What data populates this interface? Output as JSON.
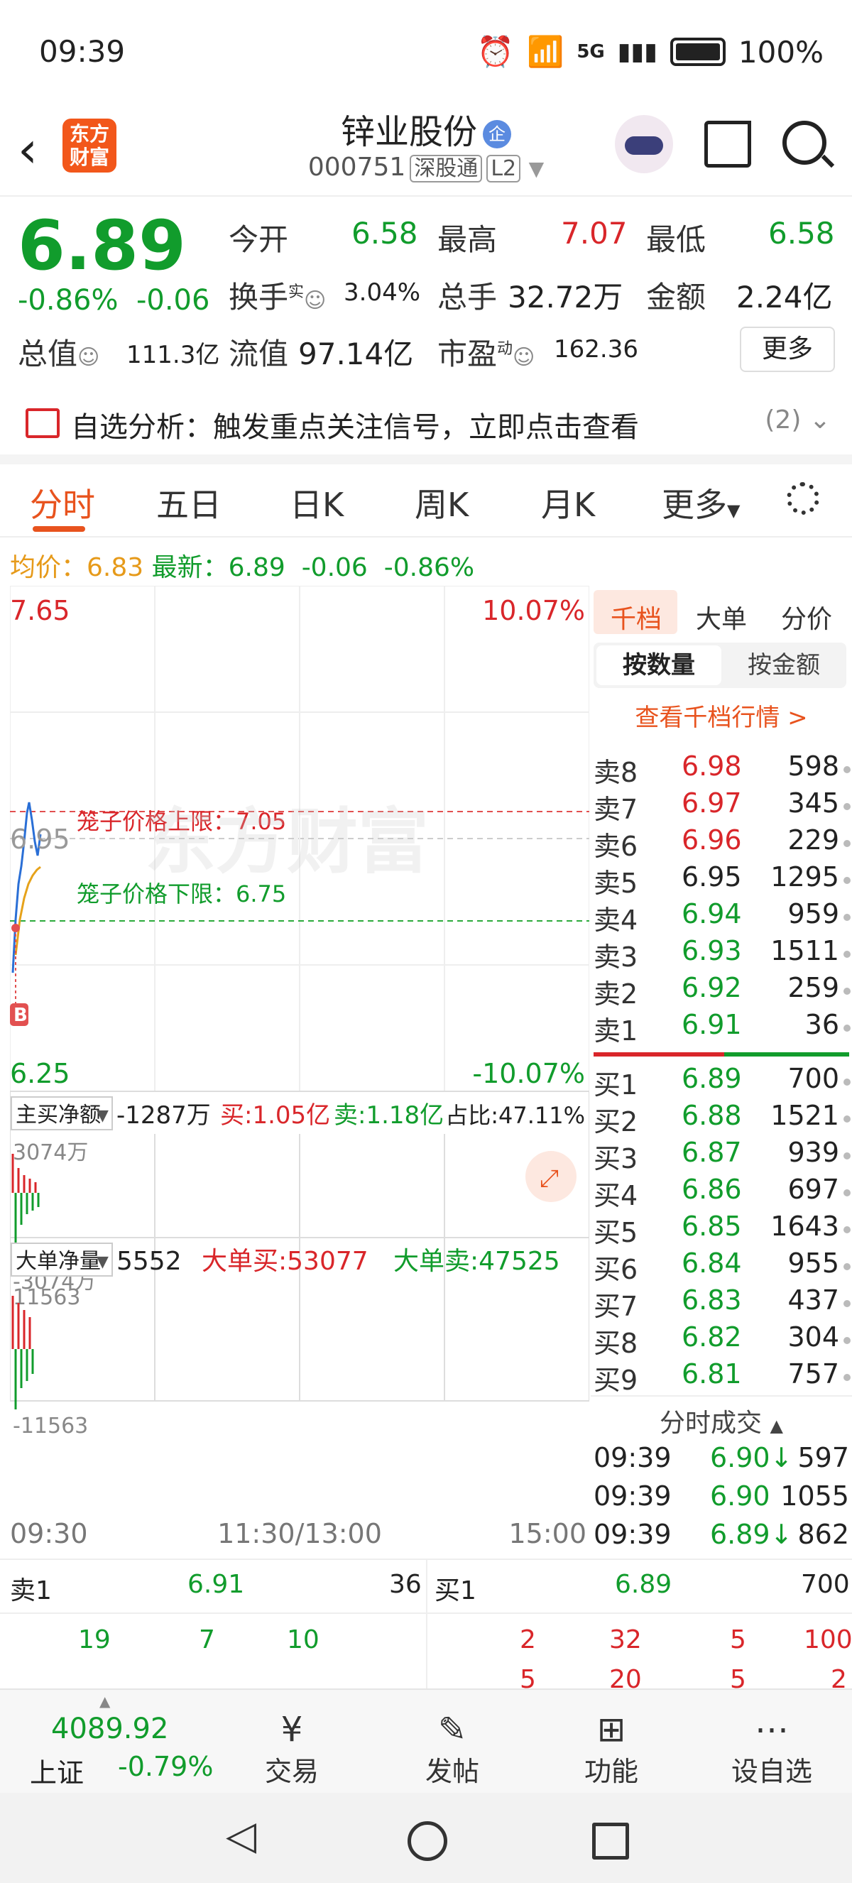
{
  "status": {
    "time": "09:39",
    "network": "5G",
    "battery": "100%"
  },
  "header": {
    "logo_line1": "东方",
    "logo_line2": "财富",
    "name": "锌业股份",
    "badge": "企",
    "code": "000751",
    "tag1": "深股通",
    "tag2": "L2"
  },
  "quote": {
    "price": "6.89",
    "change_pct": "-0.86%",
    "change": "-0.06",
    "open_label": "今开",
    "open": "6.58",
    "high_label": "最高",
    "high": "7.07",
    "low_label": "最低",
    "low": "6.58",
    "turnover_label": "换手",
    "turnover_sup": "实",
    "turnover": "3.04%",
    "volume_label": "总手",
    "volume": "32.72万",
    "amount_label": "金额",
    "amount": "2.24亿",
    "total_cap_label": "总值",
    "total_cap": "111.3亿",
    "float_cap_label": "流值",
    "float_cap": "97.14亿",
    "pe_label": "市盈",
    "pe_sup": "动",
    "pe": "162.36",
    "more": "更多"
  },
  "analysis": {
    "text": "自选分析：触发重点关注信号，立即点击查看",
    "count": "(2)"
  },
  "tabs": [
    "分时",
    "五日",
    "日K",
    "周K",
    "月K",
    "更多"
  ],
  "avg": {
    "avg_label": "均价：",
    "avg": "6.83",
    "latest_label": "最新：",
    "latest": "6.89",
    "chg": "-0.06",
    "pct": "-0.86%"
  },
  "chart": {
    "top_price": "7.65",
    "top_pct": "10.07%",
    "bottom_price": "6.25",
    "bottom_pct": "-10.07%",
    "mid_price": "6.95",
    "upper_limit": "笼子价格上限：7.05",
    "lower_limit": "笼子价格下限：6.75",
    "b_marker": "B",
    "watermark": "东方财富",
    "flow_label": "主买净额",
    "flow_value": "-1287万",
    "flow_buy": "买:1.05亿",
    "flow_sell": "卖:1.18亿",
    "flow_ratio": "占比:47.11%",
    "flow_top": "3074万",
    "flow_bottom": "-3074万",
    "big_label": "大单净量",
    "big_value": "5552",
    "big_buy": "大单买:53077",
    "big_sell": "大单卖:47525",
    "big_top": "11563",
    "big_bottom": "-11563",
    "time_start": "09:30",
    "time_mid": "11:30/13:00",
    "time_end": "15:00"
  },
  "orderbook": {
    "tabs": [
      "千档",
      "大单",
      "分价"
    ],
    "sub_tabs": [
      "按数量",
      "按金额"
    ],
    "link": "查看千档行情 >",
    "asks": [
      {
        "label": "卖8",
        "price": "6.98",
        "vol": "598"
      },
      {
        "label": "卖7",
        "price": "6.97",
        "vol": "345"
      },
      {
        "label": "卖6",
        "price": "6.96",
        "vol": "229"
      },
      {
        "label": "卖5",
        "price": "6.95",
        "vol": "1295"
      },
      {
        "label": "卖4",
        "price": "6.94",
        "vol": "959"
      },
      {
        "label": "卖3",
        "price": "6.93",
        "vol": "1511"
      },
      {
        "label": "卖2",
        "price": "6.92",
        "vol": "259"
      },
      {
        "label": "卖1",
        "price": "6.91",
        "vol": "36"
      }
    ],
    "bids": [
      {
        "label": "买1",
        "price": "6.89",
        "vol": "700"
      },
      {
        "label": "买2",
        "price": "6.88",
        "vol": "1521"
      },
      {
        "label": "买3",
        "price": "6.87",
        "vol": "939"
      },
      {
        "label": "买4",
        "price": "6.86",
        "vol": "697"
      },
      {
        "label": "买5",
        "price": "6.85",
        "vol": "1643"
      },
      {
        "label": "买6",
        "price": "6.84",
        "vol": "955"
      },
      {
        "label": "买7",
        "price": "6.83",
        "vol": "437"
      },
      {
        "label": "买8",
        "price": "6.82",
        "vol": "304"
      },
      {
        "label": "买9",
        "price": "6.81",
        "vol": "757"
      }
    ],
    "trades_title": "分时成交",
    "trades": [
      {
        "time": "09:39",
        "price": "6.90↓",
        "vol": "597"
      },
      {
        "time": "09:39",
        "price": "6.90",
        "vol": "1055"
      },
      {
        "time": "09:39",
        "price": "6.89↓",
        "vol": "862"
      }
    ]
  },
  "bottom_quote": {
    "ask_label": "卖1",
    "ask_price": "6.91",
    "ask_vol": "36",
    "bid_label": "买1",
    "bid_price": "6.89",
    "bid_vol": "700",
    "ask_detail": [
      "19",
      "7",
      "10"
    ],
    "bid_detail_1": [
      "2",
      "32",
      "5",
      "100"
    ],
    "bid_detail_2": [
      "5",
      "20",
      "5",
      "2"
    ]
  },
  "nav": {
    "index_value": "4089.92",
    "index_name": "上证",
    "index_pct": "-0.79%",
    "items": [
      "交易",
      "发帖",
      "功能",
      "设自选"
    ]
  }
}
